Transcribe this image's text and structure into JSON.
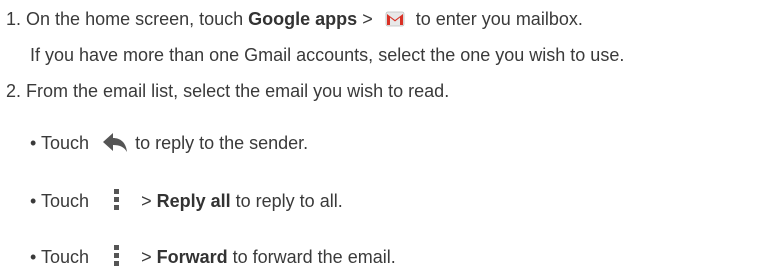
{
  "steps": [
    {
      "number": "1.",
      "text_a": "On the home screen, touch",
      "bold_a": "Google apps",
      "sep": ">",
      "icon": "gmail-icon",
      "text_b": "to enter you mailbox.",
      "note": "If you have more than one Gmail accounts, select the one you wish to use."
    },
    {
      "number": "2.",
      "text": "From the email list, select the email you wish to read."
    }
  ],
  "bullets": [
    {
      "marker": "•",
      "touch": "Touch",
      "icon": "reply-arrow-icon",
      "text": "to reply to the sender."
    },
    {
      "marker": "•",
      "touch": "Touch",
      "icon": "overflow-menu-icon",
      "sep": ">",
      "bold": "Reply all",
      "text": "to reply to all."
    },
    {
      "marker": "•",
      "touch": "Touch",
      "icon": "overflow-menu-icon",
      "sep": ">",
      "bold": "Forward",
      "text": "to forward the email."
    }
  ],
  "colors": {
    "text": "#3a3a3a",
    "gmail_red": "#d93025",
    "icon_gray": "#555555"
  }
}
